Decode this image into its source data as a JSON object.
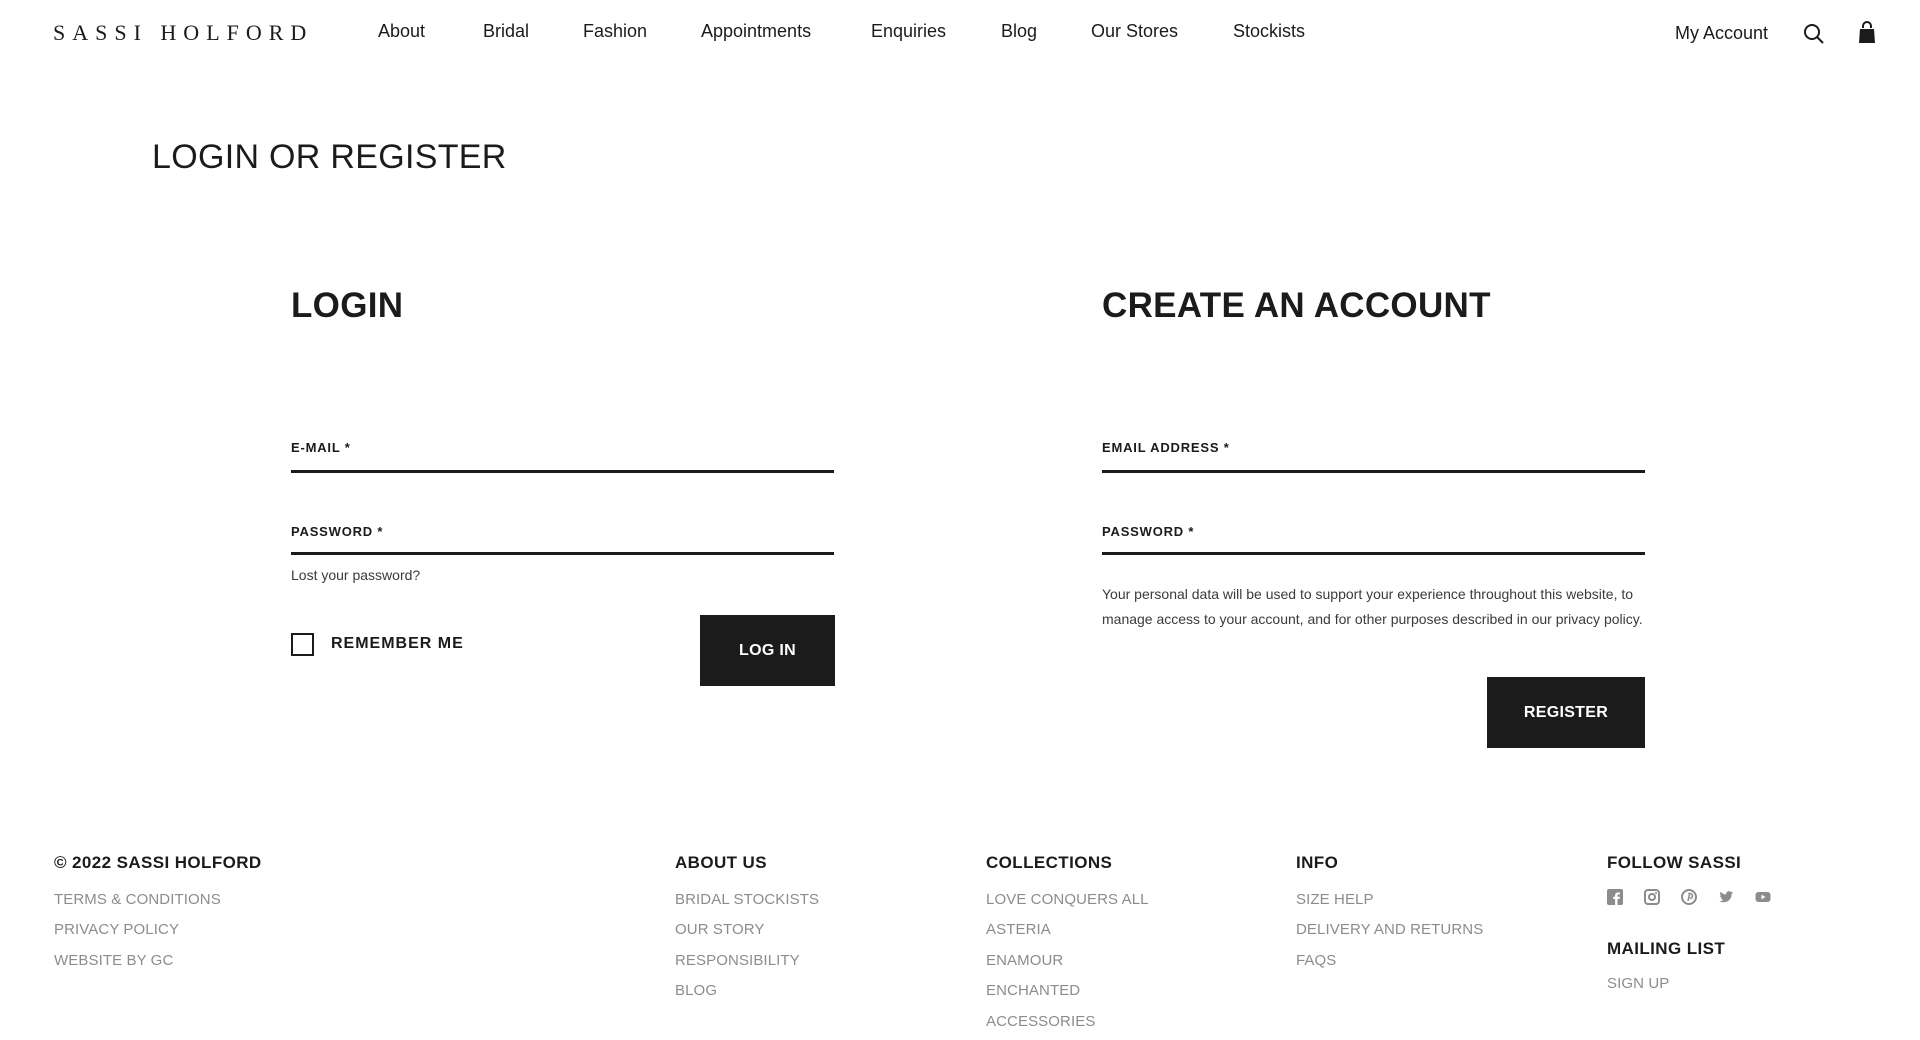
{
  "header": {
    "logo": "SASSI HOLFORD",
    "nav": [
      "About",
      "Bridal",
      "Fashion",
      "Appointments",
      "Enquiries",
      "Blog",
      "Our Stores",
      "Stockists"
    ],
    "my_account": "My Account"
  },
  "page_title": "LOGIN OR REGISTER",
  "login": {
    "title": "LOGIN",
    "email_label": "E-MAIL *",
    "email_value": "",
    "password_label": "PASSWORD *",
    "password_value": "",
    "lost_password": "Lost your password?",
    "remember_me": "REMEMBER ME",
    "remember_checked": false,
    "button": "LOG IN"
  },
  "register": {
    "title": "CREATE AN ACCOUNT",
    "email_label": "EMAIL ADDRESS *",
    "email_value": "",
    "password_label": "PASSWORD *",
    "password_value": "",
    "privacy_text": "Your personal data will be used to support your experience throughout this website, to manage access to your account, and for other purposes described in our privacy policy.",
    "button": "REGISTER"
  },
  "footer": {
    "copyright": "© 2022 SASSI HOLFORD",
    "legal_links": [
      "TERMS & CONDITIONS",
      "PRIVACY POLICY",
      "WEBSITE BY GC"
    ],
    "about": {
      "title": "ABOUT US",
      "links": [
        "BRIDAL STOCKISTS",
        "OUR STORY",
        "RESPONSIBILITY",
        "BLOG"
      ]
    },
    "collections": {
      "title": "COLLECTIONS",
      "links": [
        "LOVE CONQUERS ALL",
        "ASTERIA",
        "ENAMOUR",
        "ENCHANTED",
        "ACCESSORIES"
      ]
    },
    "info": {
      "title": "INFO",
      "links": [
        "SIZE HELP",
        "DELIVERY AND RETURNS",
        "FAQS"
      ]
    },
    "follow": {
      "title": "FOLLOW SASSI",
      "icons": [
        "facebook-icon",
        "instagram-icon",
        "pinterest-icon",
        "twitter-icon",
        "youtube-icon"
      ]
    },
    "mailing": {
      "title": "MAILING LIST",
      "link": "SIGN UP"
    }
  },
  "colors": {
    "text": "#1b1b1b",
    "footer_link": "#8c8c8c",
    "button_bg": "#1b1b1b",
    "button_text": "#ffffff"
  }
}
